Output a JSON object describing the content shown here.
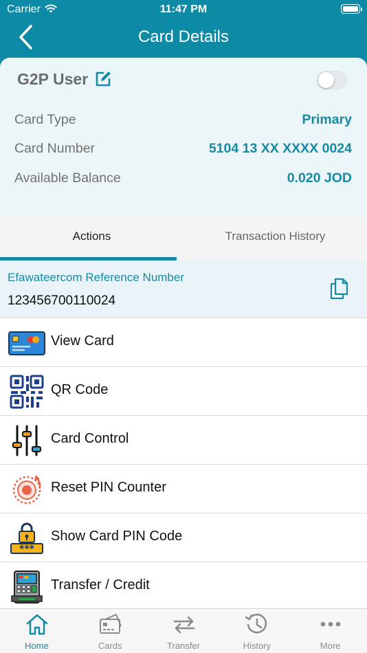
{
  "status_bar": {
    "carrier": "Carrier",
    "time": "11:47 PM"
  },
  "nav": {
    "title": "Card Details",
    "back_icon": "chevron-left-icon"
  },
  "colors": {
    "primary": "#0d8aa6",
    "accent_text": "#168aa5",
    "card_bg": "#ebf6f9",
    "reference_bg": "#eaf4f8"
  },
  "card": {
    "user_name": "G2P User",
    "toggle_on": false,
    "rows": [
      {
        "label": "Card Type",
        "value": "Primary"
      },
      {
        "label": "Card Number",
        "value": "5104 13 XX XXXX 0024"
      },
      {
        "label": "Available Balance",
        "value": "0.020 JOD"
      }
    ]
  },
  "tabs": [
    {
      "label": "Actions",
      "selected": true
    },
    {
      "label": "Transaction History",
      "selected": false
    }
  ],
  "reference": {
    "label": "Efawateercom Reference Number",
    "value": "123456700110024"
  },
  "menu": [
    {
      "label": "View Card",
      "icon": "credit-card-icon"
    },
    {
      "label": "QR Code",
      "icon": "qr-code-icon"
    },
    {
      "label": "Card Control",
      "icon": "sliders-icon"
    },
    {
      "label": "Reset PIN Counter",
      "icon": "reset-counter-icon"
    },
    {
      "label": "Show Card PIN Code",
      "icon": "lock-pin-icon"
    },
    {
      "label": "Transfer / Credit",
      "icon": "atm-icon"
    }
  ],
  "tabbar": [
    {
      "label": "Home",
      "icon": "home-icon",
      "active": true
    },
    {
      "label": "Cards",
      "icon": "card-icon",
      "active": false
    },
    {
      "label": "Transfer",
      "icon": "transfer-arrows-icon",
      "active": false
    },
    {
      "label": "History",
      "icon": "history-clock-icon",
      "active": false
    },
    {
      "label": "More",
      "icon": "more-dots-icon",
      "active": false
    }
  ]
}
